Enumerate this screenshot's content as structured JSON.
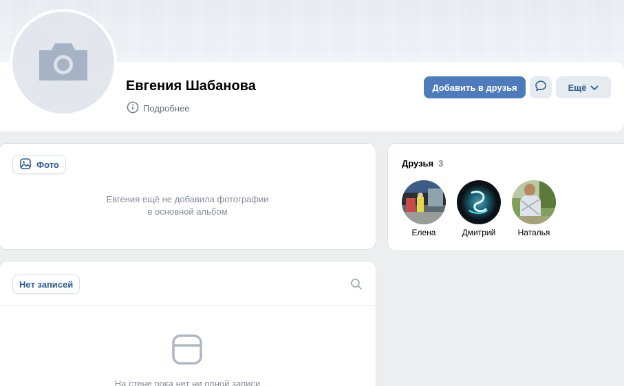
{
  "profile": {
    "name": "Евгения Шабанова",
    "more_info_label": "Подробнее",
    "add_friend_label": "Добавить в друзья",
    "more_label": "Ещё"
  },
  "photos": {
    "tab_label": "Фото",
    "empty_text_line1": "Евгения ещё не добавила фотографии",
    "empty_text_line2": "в основной альбом"
  },
  "friends": {
    "title": "Друзья",
    "count": "3",
    "items": [
      {
        "name": "Елена"
      },
      {
        "name": "Дмитрий"
      },
      {
        "name": "Наталья"
      }
    ]
  },
  "wall": {
    "tab_label": "Нет записей",
    "empty_text": "На стене пока нет ни одной записи"
  },
  "colors": {
    "accent": "#4d7bbb",
    "link": "#2c5d8f",
    "secondary_text": "#818c99",
    "background": "#edeef0"
  },
  "icons": [
    "camera-icon",
    "info-icon",
    "message-icon",
    "chevron-down-icon",
    "photo-icon",
    "search-icon",
    "empty-wall-icon"
  ]
}
